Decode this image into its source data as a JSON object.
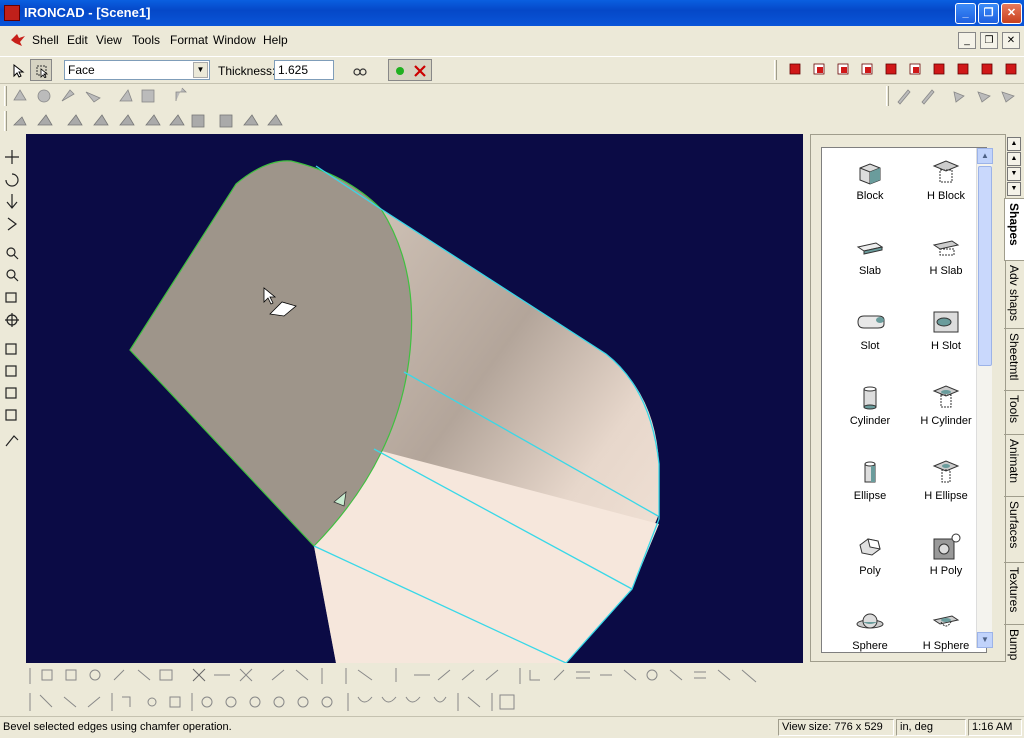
{
  "window": {
    "title": "IRONCAD - [Scene1]"
  },
  "menu": [
    "Shell",
    "Edit",
    "View",
    "Tools",
    "Format",
    "Window",
    "Help"
  ],
  "property_bar": {
    "face_select_value": "Face",
    "thickness_label": "Thickness:",
    "thickness_value": "1.625"
  },
  "catalog": {
    "shapes": [
      {
        "label": "Block",
        "icon": "block-icon"
      },
      {
        "label": "H Block",
        "icon": "h-block-icon"
      },
      {
        "label": "Slab",
        "icon": "slab-icon"
      },
      {
        "label": "H Slab",
        "icon": "h-slab-icon"
      },
      {
        "label": "Slot",
        "icon": "slot-icon"
      },
      {
        "label": "H Slot",
        "icon": "h-slot-icon"
      },
      {
        "label": "Cylinder",
        "icon": "cylinder-icon"
      },
      {
        "label": "H Cylinder",
        "icon": "h-cylinder-icon"
      },
      {
        "label": "Ellipse",
        "icon": "ellipse-icon"
      },
      {
        "label": "H Ellipse",
        "icon": "h-ellipse-icon"
      },
      {
        "label": "Poly",
        "icon": "poly-icon"
      },
      {
        "label": "H Poly",
        "icon": "h-poly-icon"
      },
      {
        "label": "Sphere",
        "icon": "sphere-icon"
      },
      {
        "label": "H Sphere",
        "icon": "h-sphere-icon"
      }
    ],
    "tabs": [
      "Shapes",
      "Adv shaps",
      "Sheetmtl",
      "Tools",
      "Animatn",
      "Surfaces",
      "Textures",
      "Bump"
    ]
  },
  "status": {
    "message": "Bevel selected edges using chamfer operation.",
    "view_size_label": "View size:",
    "view_size_value": "776 x  529",
    "units": "in, deg",
    "time": "1:16 AM"
  },
  "colors": {
    "viewport_bg": "#0b0b45",
    "face_gray": "#9e958a",
    "body_light": "#f2e2d6",
    "edge_cyan": "#38d8e8",
    "edge_green": "#40c040"
  }
}
